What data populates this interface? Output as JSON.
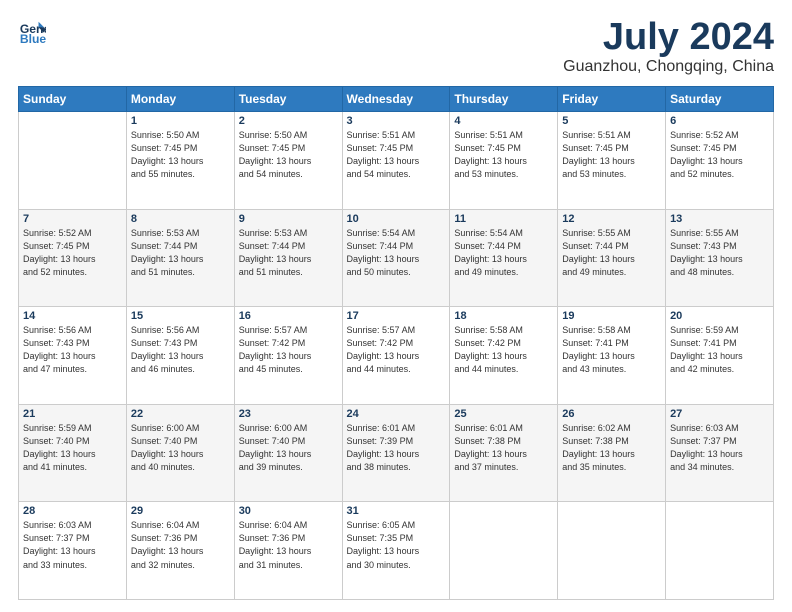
{
  "header": {
    "logo_line1": "General",
    "logo_line2": "Blue",
    "month": "July 2024",
    "location": "Guanzhou, Chongqing, China"
  },
  "days_of_week": [
    "Sunday",
    "Monday",
    "Tuesday",
    "Wednesday",
    "Thursday",
    "Friday",
    "Saturday"
  ],
  "weeks": [
    [
      {
        "day": "",
        "info": ""
      },
      {
        "day": "1",
        "info": "Sunrise: 5:50 AM\nSunset: 7:45 PM\nDaylight: 13 hours\nand 55 minutes."
      },
      {
        "day": "2",
        "info": "Sunrise: 5:50 AM\nSunset: 7:45 PM\nDaylight: 13 hours\nand 54 minutes."
      },
      {
        "day": "3",
        "info": "Sunrise: 5:51 AM\nSunset: 7:45 PM\nDaylight: 13 hours\nand 54 minutes."
      },
      {
        "day": "4",
        "info": "Sunrise: 5:51 AM\nSunset: 7:45 PM\nDaylight: 13 hours\nand 53 minutes."
      },
      {
        "day": "5",
        "info": "Sunrise: 5:51 AM\nSunset: 7:45 PM\nDaylight: 13 hours\nand 53 minutes."
      },
      {
        "day": "6",
        "info": "Sunrise: 5:52 AM\nSunset: 7:45 PM\nDaylight: 13 hours\nand 52 minutes."
      }
    ],
    [
      {
        "day": "7",
        "info": "Sunrise: 5:52 AM\nSunset: 7:45 PM\nDaylight: 13 hours\nand 52 minutes."
      },
      {
        "day": "8",
        "info": "Sunrise: 5:53 AM\nSunset: 7:44 PM\nDaylight: 13 hours\nand 51 minutes."
      },
      {
        "day": "9",
        "info": "Sunrise: 5:53 AM\nSunset: 7:44 PM\nDaylight: 13 hours\nand 51 minutes."
      },
      {
        "day": "10",
        "info": "Sunrise: 5:54 AM\nSunset: 7:44 PM\nDaylight: 13 hours\nand 50 minutes."
      },
      {
        "day": "11",
        "info": "Sunrise: 5:54 AM\nSunset: 7:44 PM\nDaylight: 13 hours\nand 49 minutes."
      },
      {
        "day": "12",
        "info": "Sunrise: 5:55 AM\nSunset: 7:44 PM\nDaylight: 13 hours\nand 49 minutes."
      },
      {
        "day": "13",
        "info": "Sunrise: 5:55 AM\nSunset: 7:43 PM\nDaylight: 13 hours\nand 48 minutes."
      }
    ],
    [
      {
        "day": "14",
        "info": "Sunrise: 5:56 AM\nSunset: 7:43 PM\nDaylight: 13 hours\nand 47 minutes."
      },
      {
        "day": "15",
        "info": "Sunrise: 5:56 AM\nSunset: 7:43 PM\nDaylight: 13 hours\nand 46 minutes."
      },
      {
        "day": "16",
        "info": "Sunrise: 5:57 AM\nSunset: 7:42 PM\nDaylight: 13 hours\nand 45 minutes."
      },
      {
        "day": "17",
        "info": "Sunrise: 5:57 AM\nSunset: 7:42 PM\nDaylight: 13 hours\nand 44 minutes."
      },
      {
        "day": "18",
        "info": "Sunrise: 5:58 AM\nSunset: 7:42 PM\nDaylight: 13 hours\nand 44 minutes."
      },
      {
        "day": "19",
        "info": "Sunrise: 5:58 AM\nSunset: 7:41 PM\nDaylight: 13 hours\nand 43 minutes."
      },
      {
        "day": "20",
        "info": "Sunrise: 5:59 AM\nSunset: 7:41 PM\nDaylight: 13 hours\nand 42 minutes."
      }
    ],
    [
      {
        "day": "21",
        "info": "Sunrise: 5:59 AM\nSunset: 7:40 PM\nDaylight: 13 hours\nand 41 minutes."
      },
      {
        "day": "22",
        "info": "Sunrise: 6:00 AM\nSunset: 7:40 PM\nDaylight: 13 hours\nand 40 minutes."
      },
      {
        "day": "23",
        "info": "Sunrise: 6:00 AM\nSunset: 7:40 PM\nDaylight: 13 hours\nand 39 minutes."
      },
      {
        "day": "24",
        "info": "Sunrise: 6:01 AM\nSunset: 7:39 PM\nDaylight: 13 hours\nand 38 minutes."
      },
      {
        "day": "25",
        "info": "Sunrise: 6:01 AM\nSunset: 7:38 PM\nDaylight: 13 hours\nand 37 minutes."
      },
      {
        "day": "26",
        "info": "Sunrise: 6:02 AM\nSunset: 7:38 PM\nDaylight: 13 hours\nand 35 minutes."
      },
      {
        "day": "27",
        "info": "Sunrise: 6:03 AM\nSunset: 7:37 PM\nDaylight: 13 hours\nand 34 minutes."
      }
    ],
    [
      {
        "day": "28",
        "info": "Sunrise: 6:03 AM\nSunset: 7:37 PM\nDaylight: 13 hours\nand 33 minutes."
      },
      {
        "day": "29",
        "info": "Sunrise: 6:04 AM\nSunset: 7:36 PM\nDaylight: 13 hours\nand 32 minutes."
      },
      {
        "day": "30",
        "info": "Sunrise: 6:04 AM\nSunset: 7:36 PM\nDaylight: 13 hours\nand 31 minutes."
      },
      {
        "day": "31",
        "info": "Sunrise: 6:05 AM\nSunset: 7:35 PM\nDaylight: 13 hours\nand 30 minutes."
      },
      {
        "day": "",
        "info": ""
      },
      {
        "day": "",
        "info": ""
      },
      {
        "day": "",
        "info": ""
      }
    ]
  ]
}
